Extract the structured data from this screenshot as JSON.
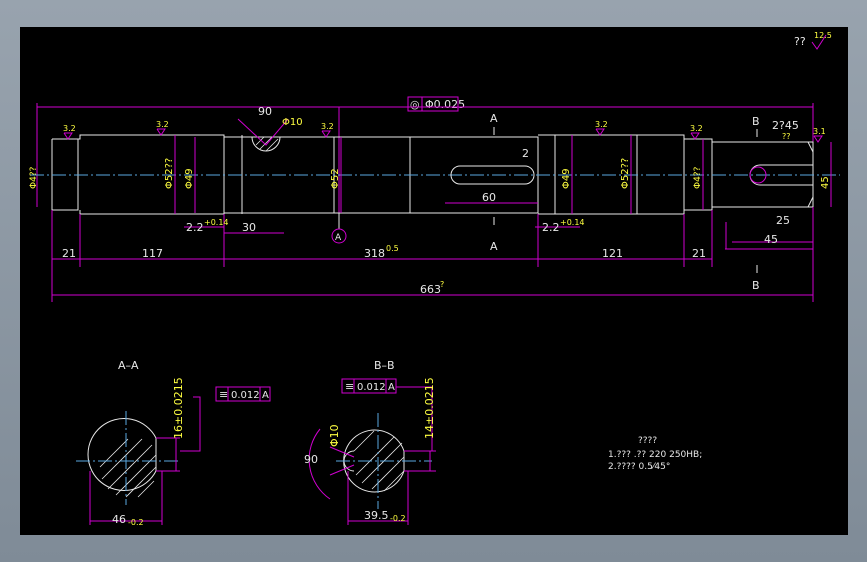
{
  "title_block": {
    "roughness_note": "??",
    "roughness_value": "12.5"
  },
  "datum_a_label": "A",
  "runout": {
    "symbol": "◎",
    "value": "Φ0.025"
  },
  "dims_top": {
    "angle_key": "90",
    "hole_dia": "Φ10",
    "taper_chamfer": "2?45",
    "taper_sub": "??",
    "section_a1": "A",
    "section_a2": "A",
    "section_b1": "B",
    "section_b2": "B",
    "keyway_depth": "2"
  },
  "diameters": {
    "d1": "Φ4??",
    "d2": "Φ52??",
    "d3": "Φ49",
    "d4": "Φ52",
    "d5": "Φ49",
    "d6": "Φ52??",
    "d7": "Φ4??",
    "d8": "45"
  },
  "roughness_marks": [
    "3.2",
    "3.2",
    "3.2",
    "3.2",
    "3.2",
    "3.1"
  ],
  "dims_bottom": {
    "len_21a": "21",
    "len_117": "117",
    "len_318": "318",
    "len_318_tol": "0.5",
    "len_121": "121",
    "len_21b": "21",
    "len_total": "663",
    "len_total_tol": "?",
    "len_30": "30",
    "len_60": "60",
    "len_25": "25",
    "len_45": "45",
    "groove1": "2.2",
    "groove1_tol": "+0.14",
    "groove2": "2.2",
    "groove2_tol": "+0.14"
  },
  "section_aa": {
    "title": "A–A",
    "tol_symbol": "≡",
    "tol_value": "0.012",
    "tol_datum": "A",
    "key_width": "16±0.0215",
    "dia": "46",
    "dia_tol": "-0.2"
  },
  "section_bb": {
    "title": "B–B",
    "tol_symbol": "≡",
    "tol_value": "0.012",
    "tol_datum": "A",
    "key_width": "14±0.0215",
    "hole": "Φ10",
    "angle": "90",
    "dia": "39.5",
    "dia_tol": "-0.2"
  },
  "notes": {
    "heading": "????",
    "line1": "1.???     .??  220 250HB;",
    "line2": "2.????     0.5⁄45°"
  }
}
